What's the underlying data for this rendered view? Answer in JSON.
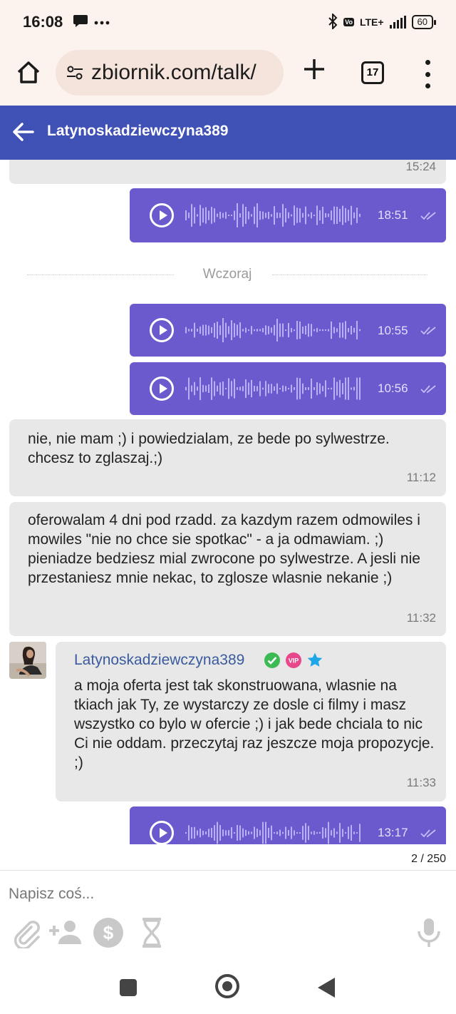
{
  "status_bar": {
    "time": "16:08",
    "left_icons": [
      "chat-bubble-icon",
      "more-dots-icon"
    ],
    "network": "LTE+",
    "battery": "60"
  },
  "browser": {
    "url": "zbiornik.com/talk/",
    "tab_count": "17"
  },
  "chat": {
    "title": "Latynoskadziewczyna389",
    "day_separator": "Wczoraj",
    "messages": [
      {
        "direction": "in",
        "type": "text",
        "text": "",
        "time": "15:24"
      },
      {
        "direction": "out",
        "type": "voice",
        "time": "18:51"
      },
      {
        "direction": "out",
        "type": "voice",
        "time": "10:55"
      },
      {
        "direction": "out",
        "type": "voice",
        "time": "10:56"
      },
      {
        "direction": "in",
        "type": "text",
        "text": "nie, nie mam ;) i powiedzialam, ze bede po sylwestrze. chcesz to zglaszaj.;)",
        "time": "11:12"
      },
      {
        "direction": "in",
        "type": "text",
        "text": "oferowalam 4 dni pod rzadd. za kazdym razem odmowiles i mowiles \"nie no chce sie spotkac\" - a ja odmawiam. ;) pieniadze bedziesz mial zwrocone po sylwestrze. A jesli nie przestaniesz mnie nekac, to zglosze wlasnie nekanie ;)",
        "time": "11:32"
      },
      {
        "direction": "in",
        "type": "text",
        "sender": "Latynoskadziewczyna389",
        "text": "a moja oferta jest tak skonstruowana, wlasnie na tkiach jak Ty, ze wystarczy ze dosle ci filmy i masz wszystko co bylo w ofercie ;) i jak bede chciala to nic Ci nie oddam. przeczytaj raz jeszcze moja propozycje. ;)",
        "time": "11:33"
      },
      {
        "direction": "out",
        "type": "voice",
        "time": "13:17"
      }
    ],
    "sender_badges": [
      "verified-check-icon",
      "vip-badge-icon",
      "star-icon"
    ],
    "vip_label": "VIP"
  },
  "page_counter": "2 / 250",
  "compose": {
    "placeholder": "Napisz coś...",
    "tools": [
      "attachment-icon",
      "add-person-icon",
      "dollar-icon",
      "hourglass-icon"
    ],
    "mic": "microphone-icon"
  },
  "colors": {
    "header": "#3f51b5",
    "outgoing_bubble": "#6a5acd",
    "incoming_bubble": "#e8e8e8",
    "sender_name": "#3a5a9e",
    "browser_bar": "#fdf3ee"
  }
}
